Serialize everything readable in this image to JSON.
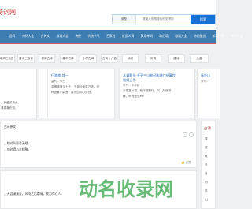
{
  "brand": "诗词网",
  "search": {
    "category": "类型",
    "placeholder": "请输入你想搜索的关键词",
    "button": "搜索"
  },
  "nav": [
    "首页",
    "诗词大全",
    "古诗文",
    "成语大全",
    "诗经",
    "传统节气",
    "百家姓",
    "近反义词",
    "英语单词",
    "歇后语",
    "谜语大全",
    "诗词鉴赏",
    "知识问答",
    "知识大全"
  ],
  "tags": [
    "宋词三百首",
    "唐诗三百首",
    "初中古诗",
    "高中古诗",
    "小学古诗",
    "古诗十九首",
    "诗经",
    "宋词",
    "唐诗",
    "元曲"
  ],
  "cards": [
    {
      "title": "",
      "author": "",
      "lines": [
        "，我爱溪舟头，",
        "清泉瀑布流，"
      ]
    },
    {
      "title": "",
      "author": "",
      "lines": [
        "",
        ""
      ]
    },
    {
      "title": "行路难·其一",
      "author": "唐代：李白",
      "lines": [
        "金樽清酒斗十千，玉盘珍羞直万钱。停",
        "杯投箸不能食，拔剑四顾心茫然。"
      ]
    },
    {
      "title": "水调歌头·壬子三山被召陈端仁给事饮",
      "title2": "饯席上作",
      "author": "宋代：辛弃疾",
      "lines": [
        "长恨复长恨，裁作短歌行。何人为我楚",
        "舞，听我楚狂声？"
      ]
    },
    {
      "title": "咏怀山",
      "author": "宋代：",
      "lines": [
        "",
        ""
      ]
    }
  ],
  "main": {
    "title": "古诗原文",
    "line1": "，相对风雨总无眠。",
    "line2": "，何时得与众相聚。",
    "like": "点赞"
  },
  "main2": {
    "watermark": "动名收录网",
    "text": "，天涯漫漫去，风雨之后看晴，故为何心人。"
  },
  "side": {
    "heading": "古诗",
    "items": [
      "春",
      "夏",
      "秋",
      "冬",
      "月",
      "雨",
      "花",
      "山"
    ]
  }
}
